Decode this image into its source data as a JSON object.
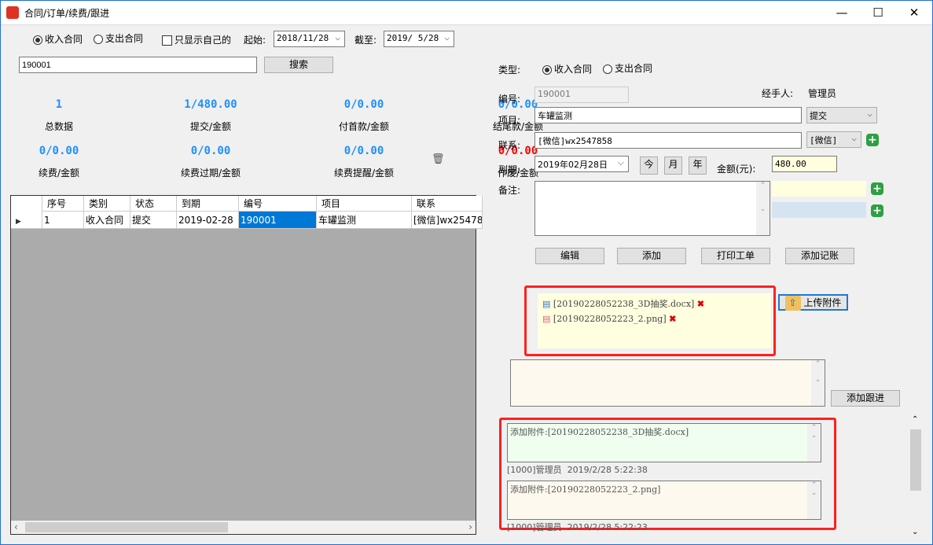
{
  "window": {
    "title": "合同/订单/续费/跟进"
  },
  "filter": {
    "income_label": "收入合同",
    "expense_label": "支出合同",
    "only_mine_label": "只显示自己的",
    "start_label": "起始:",
    "start_value": "2018/11/28",
    "end_label": "截至:",
    "end_value": "2019/ 5/28",
    "search_value": "190001",
    "search_button": "搜索"
  },
  "stats": [
    {
      "value": "1",
      "label": "总数据"
    },
    {
      "value": "1/480.00",
      "label": "提交/金额"
    },
    {
      "value": "0/0.00",
      "label": "付首款/金额"
    },
    {
      "value": "0/0.00",
      "label": "结尾款/金额"
    },
    {
      "value": "0/0.00",
      "label": "续费/金额"
    },
    {
      "value": "0/0.00",
      "label": "续费过期/金额"
    },
    {
      "value": "0/0.00",
      "label": "续费提醒/金额"
    },
    {
      "value": "0/0.00",
      "label": "作废/金额"
    }
  ],
  "colors": {
    "stat_blue": "#1e90ff",
    "stat_red": "#ff0000",
    "selection": "#0078d7",
    "highlight_red": "#ff2020"
  },
  "table": {
    "columns": [
      "序号",
      "类别",
      "状态",
      "到期",
      "编号",
      "项目",
      "联系"
    ],
    "rows": [
      [
        "1",
        "收入合同",
        "提交",
        "2019-02-28",
        "190001",
        "车罐监测",
        "[微信]wx25478"
      ]
    ]
  },
  "form": {
    "type_label": "类型:",
    "type_income": "收入合同",
    "type_expense": "支出合同",
    "id_label": "编号:",
    "id_value": "190001",
    "handler_label": "经手人:",
    "handler_value": "管理员",
    "project_label": "项目:",
    "project_value": "车罐监测",
    "status_value": "提交",
    "contact_label": "联系:",
    "contact_value": "[微信]wx2547858",
    "contact_type": "[微信]",
    "due_label": "到期:",
    "due_value": "2019年02月28日",
    "today": "今",
    "month": "月",
    "year": "年",
    "amount_label": "金额(元):",
    "amount_value": "480.00",
    "note_label": "备注:",
    "edit": "编辑",
    "add": "添加",
    "print": "打印工单",
    "add_account": "添加记账"
  },
  "attachments": {
    "files": [
      "[20190228052238_3D抽奖.docx]",
      "[20190228052223_2.png]"
    ],
    "upload": "上传附件"
  },
  "followup": {
    "add_button": "添加跟进",
    "entries": [
      {
        "text": "添加附件:[20190228052238_3D抽奖.docx]",
        "meta": "[1000]管理员  2019/2/28 5:22:38"
      },
      {
        "text": "添加附件:[20190228052223_2.png]",
        "meta": "[1000]管理员  2019/2/28 5:22:23"
      }
    ]
  }
}
